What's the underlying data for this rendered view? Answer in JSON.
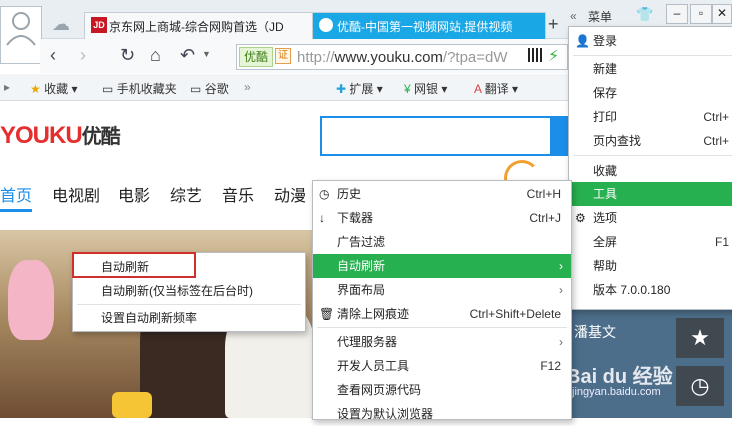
{
  "tabs": [
    {
      "label": "京东网上商城-综合网购首选（JD",
      "logo": "JD"
    },
    {
      "label": "优酷-中国第一视频网站,提供视频"
    }
  ],
  "topbar": {
    "menu_label": "菜单"
  },
  "address": {
    "site_tag": "优酷",
    "cert": "证",
    "url_prefix": "http://",
    "url_domain": "www.youku.com",
    "url_rest": "/?tpa=dW"
  },
  "bookmarks": [
    "收藏",
    "手机收藏夹",
    "谷歌",
    "扩展",
    "网银",
    "翻译"
  ],
  "page": {
    "logo_en": "YOUKU",
    "logo_cn": "优酷",
    "nav": [
      "首页",
      "电视剧",
      "电影",
      "综艺",
      "音乐",
      "动漫"
    ],
    "thumb_text": "潘基文",
    "watermark": "Bai du 经验",
    "watermark_url": "jingyan.baidu.com"
  },
  "main_menu": {
    "items": [
      {
        "label": "登录"
      },
      {
        "label": "新建"
      },
      {
        "label": "保存"
      },
      {
        "label": "打印",
        "shortcut": "Ctrl+"
      },
      {
        "label": "页内查找",
        "shortcut": "Ctrl+"
      },
      {
        "label": "收藏"
      },
      {
        "label": "工具"
      },
      {
        "label": "选项"
      },
      {
        "label": "全屏",
        "shortcut": "F1"
      },
      {
        "label": "帮助"
      },
      {
        "label": "版本 7.0.0.180"
      }
    ]
  },
  "tools_menu": {
    "items": [
      {
        "label": "历史",
        "shortcut": "Ctrl+H"
      },
      {
        "label": "下载器",
        "shortcut": "Ctrl+J"
      },
      {
        "label": "广告过滤"
      },
      {
        "label": "自动刷新"
      },
      {
        "label": "界面布局"
      },
      {
        "label": "清除上网痕迹",
        "shortcut": "Ctrl+Shift+Delete"
      },
      {
        "label": "代理服务器"
      },
      {
        "label": "开发人员工具",
        "shortcut": "F12"
      },
      {
        "label": "查看网页源代码"
      },
      {
        "label": "设置为默认浏览器"
      }
    ]
  },
  "refresh_menu": {
    "items": [
      {
        "label": "自动刷新"
      },
      {
        "label": "自动刷新(仅当标签在后台时)"
      },
      {
        "label": "设置自动刷新频率"
      }
    ]
  },
  "colors": {
    "highlight": "#27b04f",
    "youku_blue": "#1a8ee8",
    "youku_red": "#e52e2e",
    "annotation_red": "#d0302c"
  }
}
